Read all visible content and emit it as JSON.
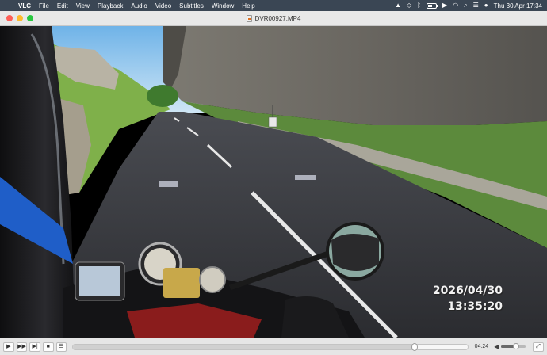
{
  "menubar": {
    "app_name": "VLC",
    "menus": [
      "File",
      "Edit",
      "View",
      "Playback",
      "Audio",
      "Video",
      "Subtitles",
      "Window",
      "Help"
    ],
    "status_icons": [
      "vlc-cone-icon",
      "dropbox-icon",
      "bluetooth-icon",
      "battery-icon",
      "play-icon",
      "wifi-icon",
      "search-icon",
      "control-center-icon",
      "siri-icon"
    ],
    "battery_level": 0.6,
    "clock": "Thu 30 Apr  17:34"
  },
  "window": {
    "title": "DVR00927.MP4"
  },
  "video": {
    "overlay_date": "2026/04/30",
    "overlay_time": "13:35:20"
  },
  "controls": {
    "buttons": [
      "play",
      "fast-forward",
      "skip-forward",
      "stop",
      "playlist"
    ],
    "progress": 0.865,
    "elapsed": "04:24",
    "volume": 0.6
  },
  "colors": {
    "menubar_bg": "#3a4654",
    "titlebar_bg": "#e8e8e8",
    "controls_bg": "#e6e6e6"
  }
}
